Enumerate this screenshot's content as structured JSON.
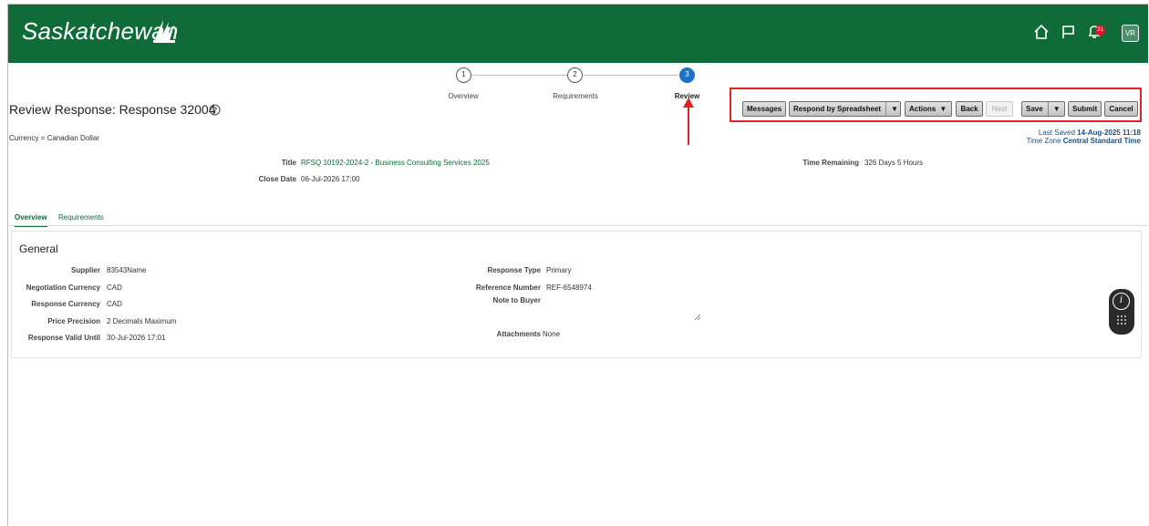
{
  "header": {
    "brand": "Saskatchewan",
    "notification_count": "31",
    "avatar_initials": "VR",
    "icons": [
      "home-icon",
      "flag-icon",
      "bell-icon"
    ],
    "colors": {
      "brand_green": "#0f6b38",
      "badge_red": "#e3142b"
    }
  },
  "train": {
    "steps": [
      {
        "number": "1",
        "label": "Overview"
      },
      {
        "number": "2",
        "label": "Requirements"
      },
      {
        "number": "3",
        "label": "Review"
      }
    ],
    "active_step": "3"
  },
  "page": {
    "title": "Review Response: Response 32004",
    "currency_note": "Currency = Canadian Dollar"
  },
  "toolbar": {
    "messages": "Messages",
    "respond_by_spreadsheet": "Respond by Spreadsheet",
    "actions": "Actions",
    "back": "Back",
    "next": "Next",
    "save": "Save",
    "submit": "Submit",
    "cancel": "Cancel"
  },
  "status": {
    "last_saved_label": "Last Saved",
    "last_saved_value": "14-Aug-2025 11:18",
    "time_zone_label": "Time Zone",
    "time_zone_value": "Central Standard Time"
  },
  "summary": {
    "title_label": "Title",
    "title_value": "RFSQ 10192-2024-2 - Business Consulting Services 2025",
    "close_date_label": "Close Date",
    "close_date_value": "06-Jul-2026 17:00",
    "time_remaining_label": "Time Remaining",
    "time_remaining_value": "326 Days 5 Hours"
  },
  "tabs": [
    {
      "label": "Overview"
    },
    {
      "label": "Requirements"
    }
  ],
  "general": {
    "heading": "General",
    "supplier_label": "Supplier",
    "supplier_value": "83543Name",
    "negotiation_currency_label": "Negotiation Currency",
    "negotiation_currency_value": "CAD",
    "response_currency_label": "Response Currency",
    "response_currency_value": "CAD",
    "price_precision_label": "Price Precision",
    "price_precision_value": "2 Decimals Maximum",
    "response_valid_until_label": "Response Valid Until",
    "response_valid_until_value": "30-Jul-2026 17:01",
    "response_type_label": "Response Type",
    "response_type_value": "Primary",
    "reference_number_label": "Reference Number",
    "reference_number_value": "REF-6548974",
    "note_to_buyer_label": "Note to Buyer",
    "note_to_buyer_value": "",
    "attachments_label": "Attachments",
    "attachments_value": "None"
  },
  "assistant": {
    "icons": [
      "info-icon",
      "keypad-icon"
    ]
  }
}
